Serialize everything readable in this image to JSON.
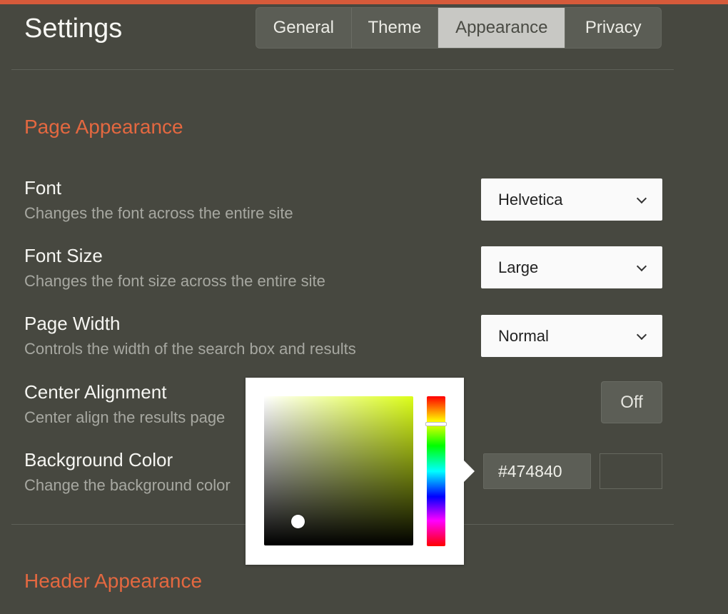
{
  "header": {
    "title": "Settings",
    "accent_color": "#d65a3a",
    "tabs": [
      {
        "label": "General"
      },
      {
        "label": "Theme"
      },
      {
        "label": "Appearance"
      },
      {
        "label": "Privacy"
      }
    ],
    "active_tab": "Appearance"
  },
  "page_appearance": {
    "title": "Page Appearance",
    "font": {
      "label": "Font",
      "description": "Changes the font across the entire site",
      "value": "Helvetica"
    },
    "font_size": {
      "label": "Font Size",
      "description": "Changes the font size across the entire site",
      "value": "Large"
    },
    "page_width": {
      "label": "Page Width",
      "description": "Controls the width of the search box and results",
      "value": "Normal"
    },
    "center_alignment": {
      "label": "Center Alignment",
      "description": "Center align the results page",
      "value": "Off"
    },
    "background_color": {
      "label": "Background Color",
      "description": "Change the background color",
      "value": "#474840"
    }
  },
  "color_picker": {
    "hue_color": "#dcfe19"
  },
  "header_appearance": {
    "title": "Header Appearance"
  }
}
